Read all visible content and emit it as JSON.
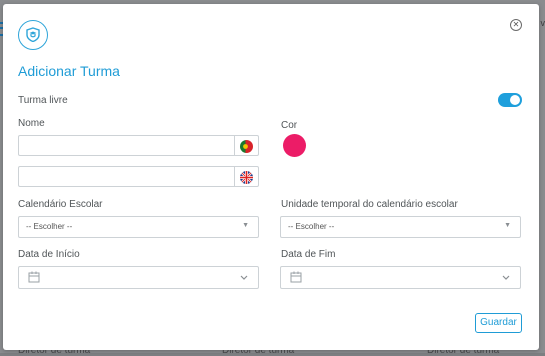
{
  "background": {
    "right_text": "v",
    "footer_labels": [
      "Diretor de turma",
      "Diretor de turma",
      "Diretor de turma"
    ]
  },
  "modal": {
    "title": "Adicionar Turma",
    "close_icon": "close-circle-icon",
    "logo_icon": "school-shield-icon",
    "free_class": {
      "label": "Turma livre",
      "enabled": true
    },
    "name": {
      "label": "Nome",
      "pt_value": "",
      "en_value": "",
      "pt_flag": "portugal-flag-icon",
      "en_flag": "uk-flag-icon"
    },
    "color": {
      "label": "Cor",
      "value": "#ec1c67"
    },
    "school_calendar": {
      "label": "Calendário Escolar",
      "selected": "-- Escolher --"
    },
    "time_unit": {
      "label": "Unidade temporal do calendário escolar",
      "selected": "-- Escolher --"
    },
    "start_date": {
      "label": "Data de Início",
      "value": ""
    },
    "end_date": {
      "label": "Data de Fim",
      "value": ""
    },
    "save_label": "Guardar"
  },
  "colors": {
    "accent": "#1f9cd6",
    "border": "#cdd2d6",
    "color_swatch": "#ec1c67"
  }
}
